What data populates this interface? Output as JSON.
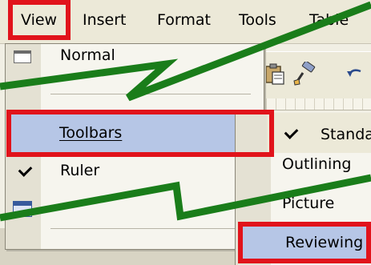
{
  "menubar": {
    "items": [
      "View",
      "Insert",
      "Format",
      "Tools",
      "Table"
    ]
  },
  "view_menu": {
    "normal_label": "Normal",
    "toolbars_label": "Toolbars",
    "ruler_label": "Ruler"
  },
  "toolbars_submenu": {
    "standard_label": "Standard",
    "outlining_label": "Outlining",
    "picture_label": "Picture",
    "reviewing_label": "Reviewing"
  },
  "colors": {
    "annotation_red": "#e1131b",
    "zigzag_green": "#1a7d1a",
    "menu_highlight": "#b6c6e6"
  },
  "icons": {
    "toolbar_icons": [
      "paste-icon",
      "format-painter-icon",
      "undo-icon"
    ]
  }
}
